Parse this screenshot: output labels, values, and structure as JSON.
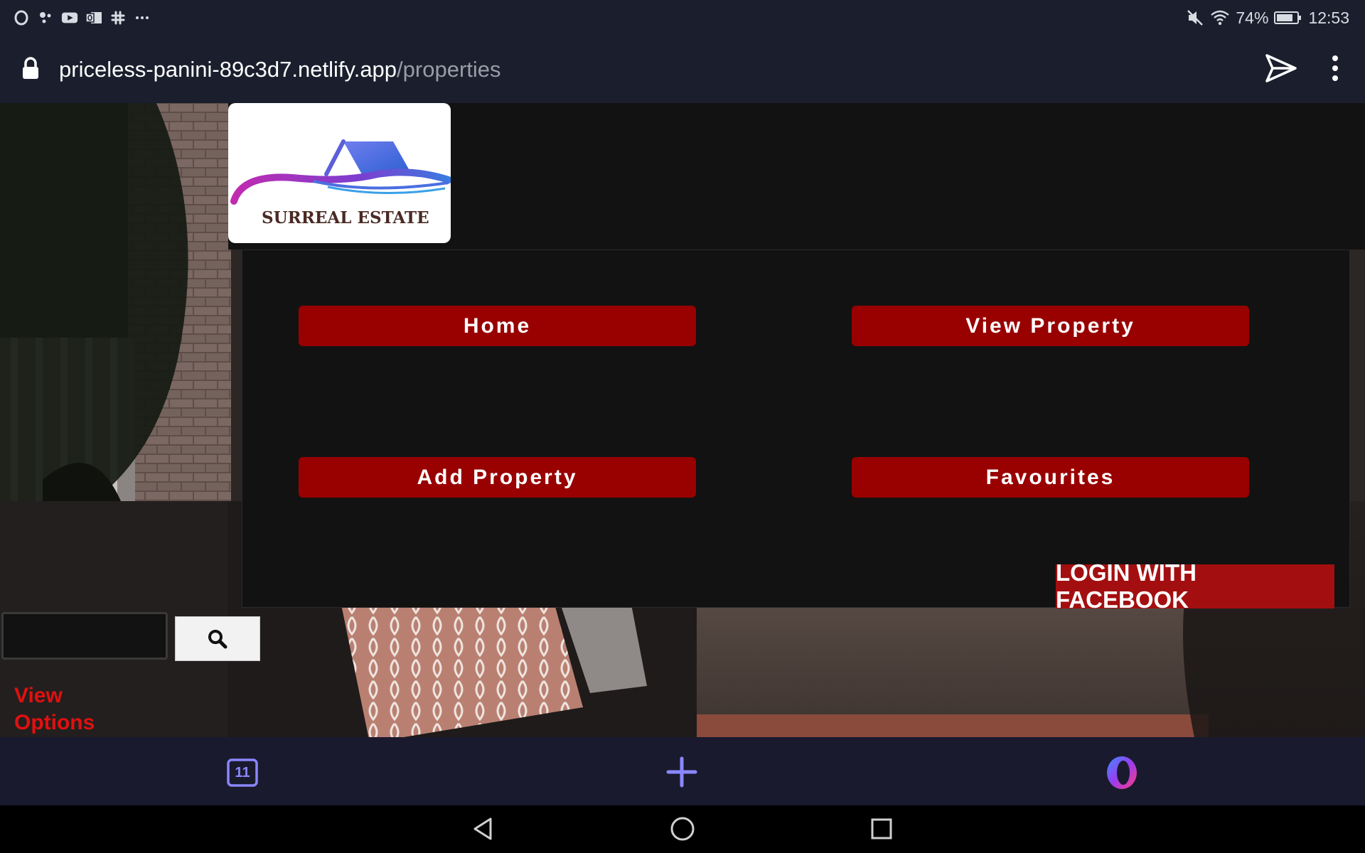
{
  "status_bar": {
    "left_icons": [
      "opera-notification-icon",
      "cluster-icon",
      "youtube-icon",
      "outlook-icon",
      "slack-icon",
      "more-dots-icon"
    ],
    "battery_percent": "74%",
    "time": "12:53"
  },
  "url_bar": {
    "domain": "priceless-panini-89c3d7.netlify.app",
    "path": "/properties"
  },
  "logo": {
    "text": "SURREAL ESTATE"
  },
  "nav": {
    "home": "Home",
    "view_property": "View Property",
    "add_property": "Add Property",
    "favourites": "Favourites"
  },
  "login": {
    "facebook_label": "LOGIN WITH FACEBOOK"
  },
  "search": {
    "value": "",
    "placeholder": ""
  },
  "view_options": {
    "label": "View Options"
  },
  "browser_bottom": {
    "tab_count": "11"
  },
  "colors": {
    "nav_button": "#990000",
    "facebook_button": "#a30f10",
    "view_options_text": "#e01010",
    "panel_bg": "#121212",
    "browser_accent": "#8a86ff"
  }
}
